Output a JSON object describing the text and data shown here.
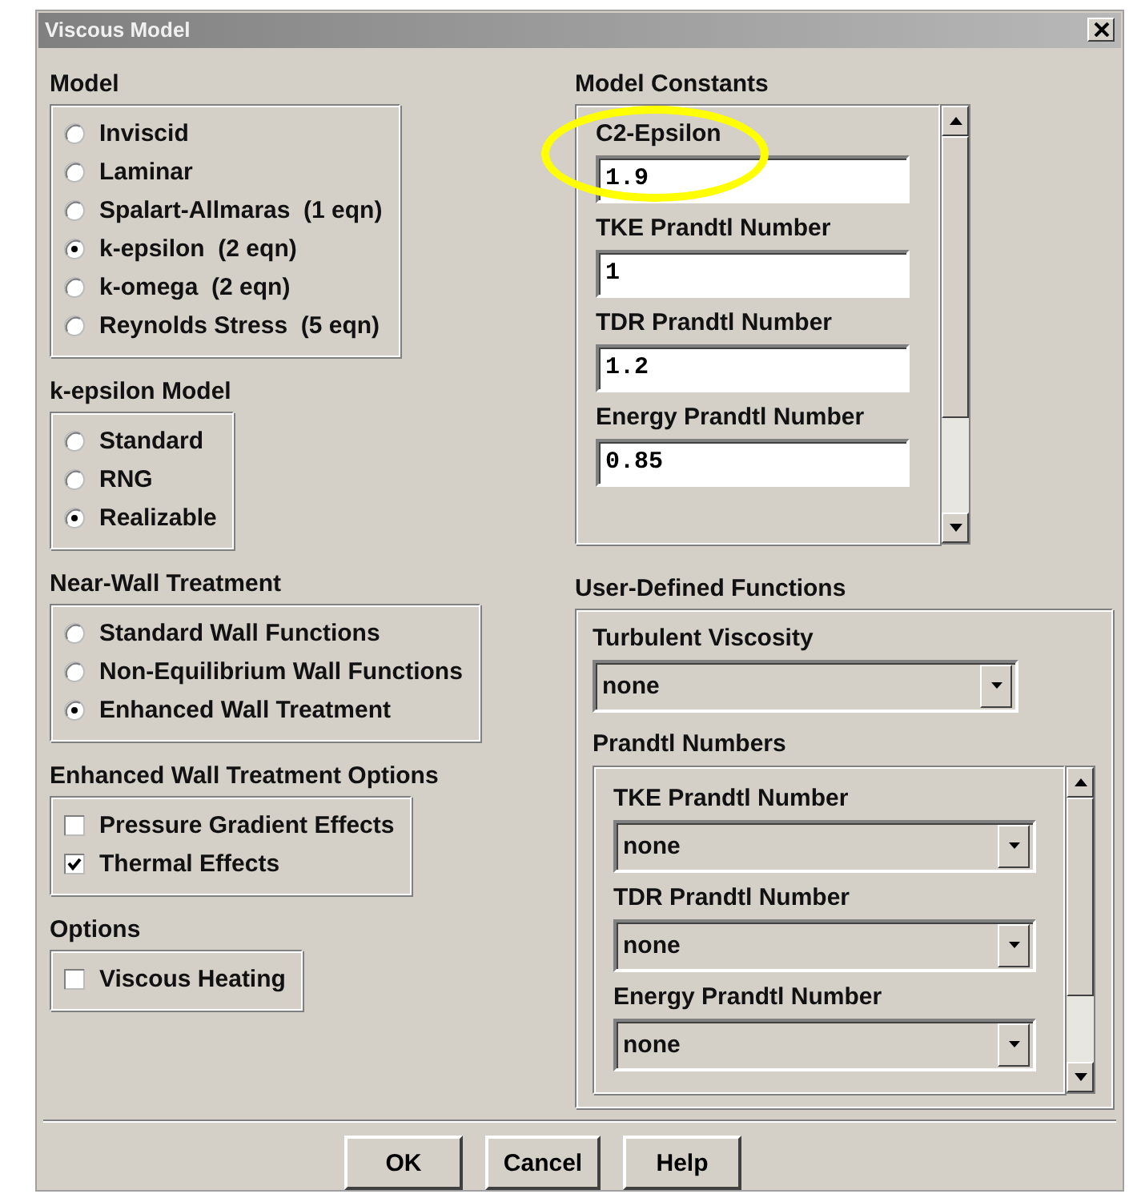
{
  "window": {
    "title": "Viscous Model"
  },
  "left_groups": [
    {
      "title": "Model",
      "kind": "radio",
      "items": [
        {
          "label": "Inviscid",
          "selected": false
        },
        {
          "label": "Laminar",
          "selected": false
        },
        {
          "label": "Spalart-Allmaras  (1 eqn)",
          "selected": false
        },
        {
          "label": "k-epsilon  (2 eqn)",
          "selected": true
        },
        {
          "label": "k-omega  (2 eqn)",
          "selected": false
        },
        {
          "label": "Reynolds Stress  (5 eqn)",
          "selected": false
        }
      ]
    },
    {
      "title": "k-epsilon Model",
      "kind": "radio",
      "items": [
        {
          "label": "Standard",
          "selected": false
        },
        {
          "label": "RNG",
          "selected": false
        },
        {
          "label": "Realizable",
          "selected": true
        }
      ]
    },
    {
      "title": "Near-Wall Treatment",
      "kind": "radio",
      "items": [
        {
          "label": "Standard Wall Functions",
          "selected": false
        },
        {
          "label": "Non-Equilibrium Wall Functions",
          "selected": false
        },
        {
          "label": "Enhanced Wall Treatment",
          "selected": true
        }
      ]
    },
    {
      "title": "Enhanced Wall Treatment Options",
      "kind": "checkbox",
      "items": [
        {
          "label": "Pressure Gradient Effects",
          "checked": false
        },
        {
          "label": "Thermal Effects",
          "checked": true
        }
      ]
    },
    {
      "title": "Options",
      "kind": "checkbox",
      "items": [
        {
          "label": "Viscous Heating",
          "checked": false
        }
      ]
    }
  ],
  "model_constants": {
    "title": "Model Constants",
    "fields": [
      {
        "label": "C2-Epsilon",
        "value": "1.9"
      },
      {
        "label": "TKE Prandtl Number",
        "value": "1"
      },
      {
        "label": "TDR Prandtl Number",
        "value": "1.2"
      },
      {
        "label": "Energy Prandtl Number",
        "value": "0.85"
      }
    ]
  },
  "user_defined_functions": {
    "title": "User-Defined Functions",
    "turbulent_viscosity": {
      "label": "Turbulent Viscosity",
      "value": "none"
    },
    "prandtl_numbers": {
      "title": "Prandtl Numbers",
      "fields": [
        {
          "label": "TKE Prandtl Number",
          "value": "none"
        },
        {
          "label": "TDR Prandtl Number",
          "value": "none"
        },
        {
          "label": "Energy Prandtl Number",
          "value": "none"
        }
      ]
    }
  },
  "annotation": {
    "kind": "circle"
  },
  "buttons": [
    "OK",
    "Cancel",
    "Help"
  ]
}
